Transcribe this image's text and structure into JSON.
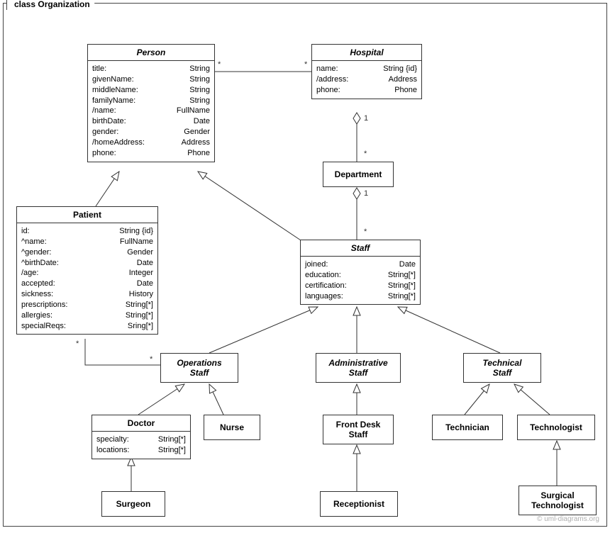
{
  "package": {
    "label": "class Organization"
  },
  "classes": {
    "person": {
      "name": "Person",
      "attrs": [
        {
          "n": "title:",
          "t": "String"
        },
        {
          "n": "givenName:",
          "t": "String"
        },
        {
          "n": "middleName:",
          "t": "String"
        },
        {
          "n": "familyName:",
          "t": "String"
        },
        {
          "n": "/name:",
          "t": "FullName"
        },
        {
          "n": "birthDate:",
          "t": "Date"
        },
        {
          "n": "gender:",
          "t": "Gender"
        },
        {
          "n": "/homeAddress:",
          "t": "Address"
        },
        {
          "n": "phone:",
          "t": "Phone"
        }
      ]
    },
    "hospital": {
      "name": "Hospital",
      "attrs": [
        {
          "n": "name:",
          "t": "String {id}"
        },
        {
          "n": "/address:",
          "t": "Address"
        },
        {
          "n": "phone:",
          "t": "Phone"
        }
      ]
    },
    "department": {
      "name": "Department"
    },
    "patient": {
      "name": "Patient",
      "attrs": [
        {
          "n": "id:",
          "t": "String {id}"
        },
        {
          "n": "^name:",
          "t": "FullName"
        },
        {
          "n": "^gender:",
          "t": "Gender"
        },
        {
          "n": "^birthDate:",
          "t": "Date"
        },
        {
          "n": "/age:",
          "t": "Integer"
        },
        {
          "n": "accepted:",
          "t": "Date"
        },
        {
          "n": "sickness:",
          "t": "History"
        },
        {
          "n": "prescriptions:",
          "t": "String[*]"
        },
        {
          "n": "allergies:",
          "t": "String[*]"
        },
        {
          "n": "specialReqs:",
          "t": "Sring[*]"
        }
      ]
    },
    "staff": {
      "name": "Staff",
      "attrs": [
        {
          "n": "joined:",
          "t": "Date"
        },
        {
          "n": "education:",
          "t": "String[*]"
        },
        {
          "n": "certification:",
          "t": "String[*]"
        },
        {
          "n": "languages:",
          "t": "String[*]"
        }
      ]
    },
    "operationsStaff": {
      "name": "Operations\nStaff"
    },
    "administrativeStaff": {
      "name": "Administrative\nStaff"
    },
    "technicalStaff": {
      "name": "Technical\nStaff"
    },
    "doctor": {
      "name": "Doctor",
      "attrs": [
        {
          "n": "specialty:",
          "t": "String[*]"
        },
        {
          "n": "locations:",
          "t": "String[*]"
        }
      ]
    },
    "nurse": {
      "name": "Nurse"
    },
    "frontDeskStaff": {
      "name": "Front Desk\nStaff"
    },
    "receptionist": {
      "name": "Receptionist"
    },
    "technician": {
      "name": "Technician"
    },
    "technologist": {
      "name": "Technologist"
    },
    "surgeon": {
      "name": "Surgeon"
    },
    "surgicalTechnologist": {
      "name": "Surgical\nTechnologist"
    }
  },
  "multiplicities": {
    "personHospital_left": "*",
    "personHospital_right": "*",
    "hospitalDept_top": "1",
    "hospitalDept_bot": "*",
    "deptStaff_top": "1",
    "deptStaff_bot": "*",
    "patientOps_patient": "*",
    "patientOps_ops": "*"
  },
  "watermark": "© uml-diagrams.org"
}
